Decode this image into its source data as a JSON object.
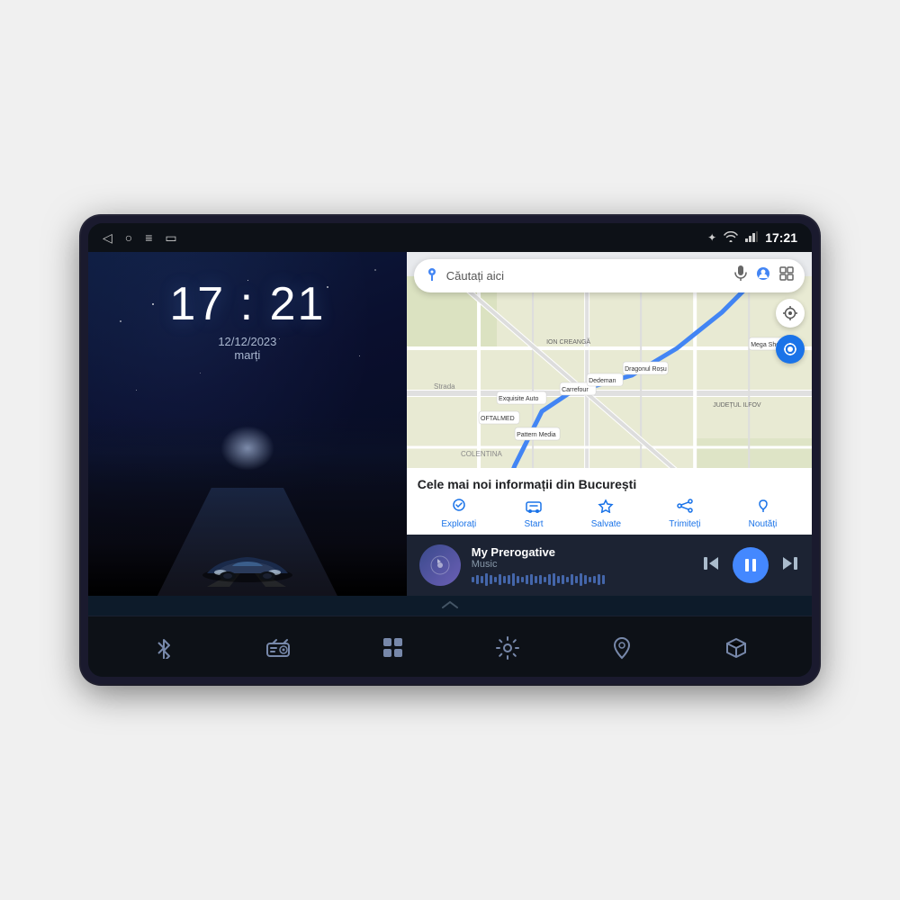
{
  "device": {
    "statusBar": {
      "time": "17:21",
      "navIcons": [
        "◁",
        "○",
        "≡",
        "▭"
      ],
      "rightIcons": [
        "bluetooth",
        "wifi",
        "signal"
      ],
      "batteryLabel": ""
    },
    "leftPanel": {
      "clockTime": "17 : 21",
      "date": "12/12/2023",
      "day": "marți"
    },
    "rightPanel": {
      "mapSearch": {
        "placeholder": "Căutați aici"
      },
      "mapInfo": {
        "title": "Cele mai noi informații din București",
        "navItems": [
          {
            "label": "Explorați",
            "icon": "🔭"
          },
          {
            "label": "Start",
            "icon": "🚘"
          },
          {
            "label": "Salvate",
            "icon": "🔖"
          },
          {
            "label": "Trimiteți",
            "icon": "📤"
          },
          {
            "label": "Noutăți",
            "icon": "🔔"
          }
        ]
      },
      "musicPlayer": {
        "title": "My Prerogative",
        "subtitle": "Music",
        "albumIcon": "♪",
        "controls": {
          "prev": "⏮",
          "play": "⏸",
          "next": "⏭"
        }
      }
    },
    "bottomDock": {
      "items": [
        {
          "name": "bluetooth",
          "icon": "bluetooth"
        },
        {
          "name": "radio",
          "icon": "radio"
        },
        {
          "name": "apps",
          "icon": "grid"
        },
        {
          "name": "settings",
          "icon": "⚙"
        },
        {
          "name": "maps",
          "icon": "maps"
        },
        {
          "name": "box",
          "icon": "📦"
        }
      ]
    }
  }
}
